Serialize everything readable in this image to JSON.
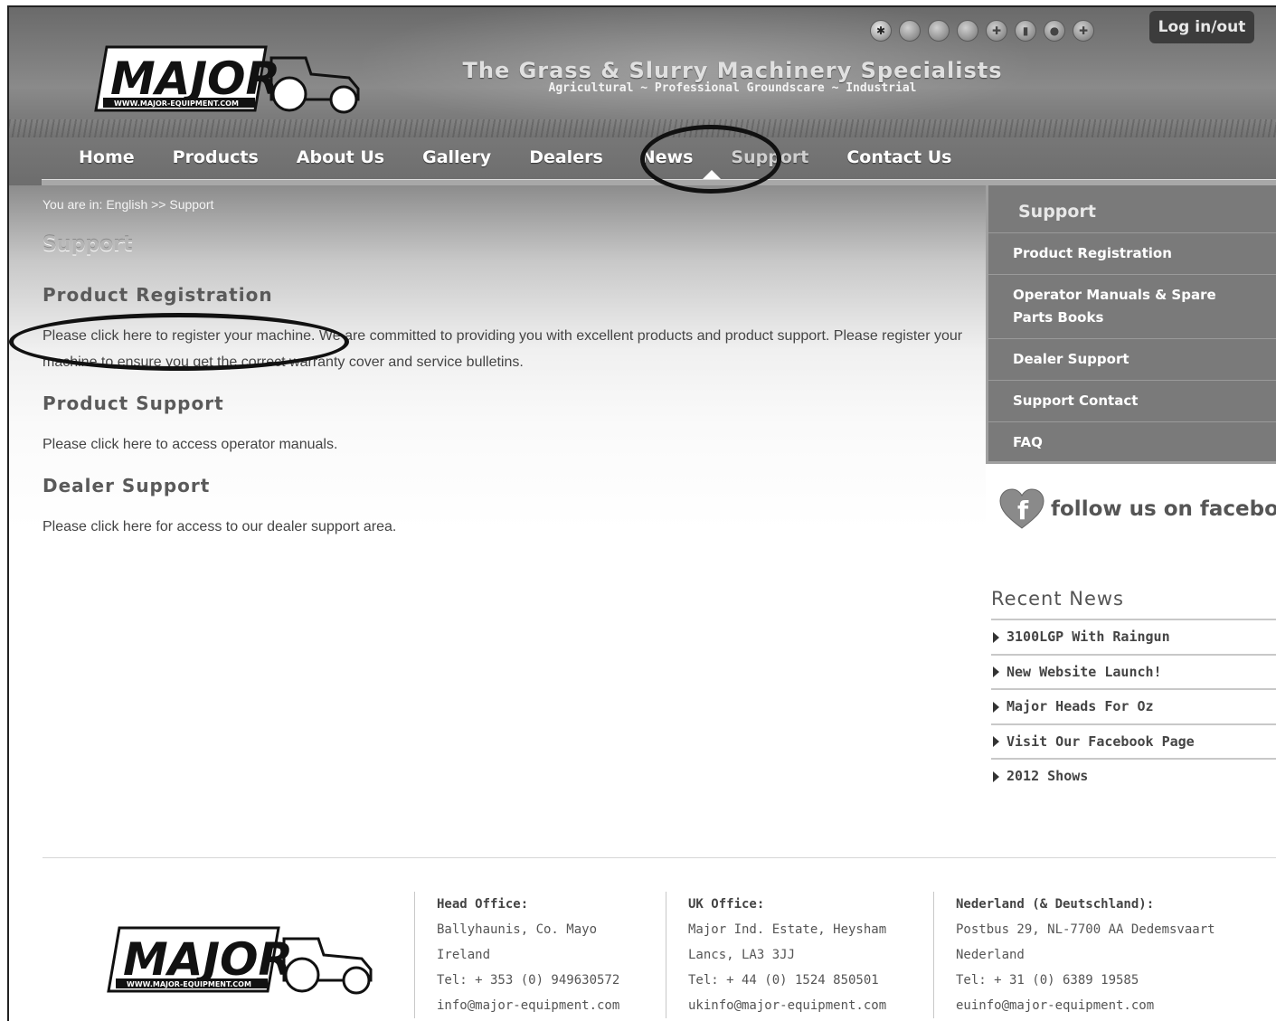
{
  "header": {
    "tagline_main": "The Grass & Slurry Machinery Specialists",
    "tagline_sub": "Agricultural ~ Professional Groundscare ~ Industrial",
    "login_label": "Log in/out",
    "logo_text": "MAJOR",
    "logo_url_text": "WWW.MAJOR-EQUIPMENT.COM"
  },
  "nav": {
    "items": [
      "Home",
      "Products",
      "About Us",
      "Gallery",
      "Dealers",
      "News",
      "Support",
      "Contact Us"
    ],
    "active": "Support"
  },
  "breadcrumb": "You are in: English >> Support",
  "page_title": "Support",
  "sections": {
    "registration": {
      "heading": "Product Registration",
      "link": "Please click here to register your machine.",
      "text": " We are committed to providing you with excellent products and product support. Please register your machine to ensure you get the correct warranty cover and service bulletins."
    },
    "product_support": {
      "heading": "Product Support",
      "prefix": "Please click here",
      "link": " to access operator manuals."
    },
    "dealer_support": {
      "heading": "Dealer Support",
      "prefix": "Please click here",
      "link": " for access to our dealer support area."
    }
  },
  "sidebar": {
    "title": "Support",
    "items": [
      "Product Registration",
      "Operator Manuals & Spare Parts Books",
      "Dealer Support",
      "Support Contact",
      "FAQ"
    ],
    "facebook": "follow us on facebook",
    "news_title": "Recent News",
    "news": [
      "3100LGP With Raingun",
      "New Website Launch!",
      "Major Heads For Oz",
      "Visit Our Facebook Page",
      "2012 Shows"
    ]
  },
  "footer": {
    "head_office": {
      "title": "Head Office:",
      "line1": "Ballyhaunis, Co. Mayo",
      "line2": "Ireland",
      "tel": "Tel: + 353 (0) 949630572",
      "email": "info@major-equipment.com"
    },
    "uk_office": {
      "title": "UK Office:",
      "line1": "Major Ind. Estate, Heysham",
      "line2": "Lancs, LA3 3JJ",
      "tel": "Tel: + 44 (0) 1524 850501",
      "email": "ukinfo@major-equipment.com"
    },
    "nl_office": {
      "title": "Nederland (& Deutschland):",
      "line1": "Postbus 29, NL-7700 AA Dedemsvaart",
      "line2": "Nederland",
      "tel": "Tel: + 31 (0) 6389 19585",
      "email": "euinfo@major-equipment.com"
    }
  },
  "flags": [
    "uk-flag-icon",
    "ireland-flag-icon",
    "france-flag-icon",
    "germany-flag-icon",
    "netherlands-flag-icon",
    "italy-flag-icon",
    "portugal-flag-icon",
    "spain-flag-icon"
  ]
}
